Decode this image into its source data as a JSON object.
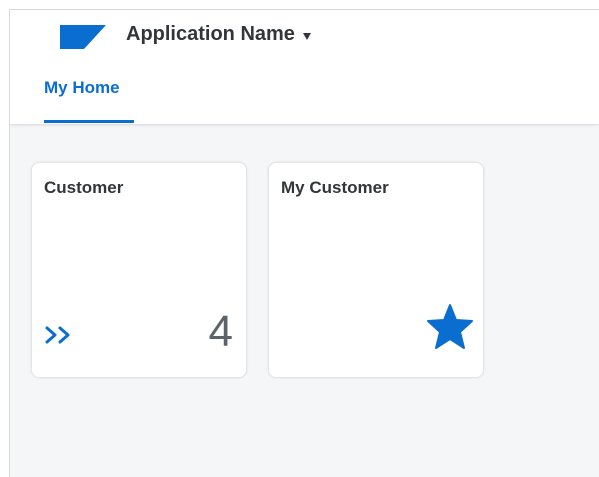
{
  "header": {
    "app_name": "Application Name",
    "logo_color": "#0a6ed1",
    "dropdown_icon": "caret-down-icon"
  },
  "tabs": [
    {
      "label": "My Home",
      "active": true
    }
  ],
  "tiles": [
    {
      "title": "Customer",
      "count": "4",
      "icon": "double-chevron-right-icon"
    },
    {
      "title": "My Customer",
      "icon": "star-icon"
    }
  ],
  "colors": {
    "accent": "#0a6ed1",
    "text": "#32363a",
    "background": "#f5f6f7"
  }
}
